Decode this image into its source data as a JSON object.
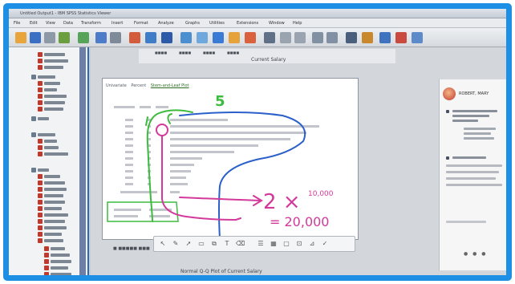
{
  "window": {
    "title": "Untitled Output1 - IBM SPSS Statistics Viewer"
  },
  "menu": [
    "File",
    "Edit",
    "View",
    "Data",
    "Transform",
    "Insert",
    "Format",
    "Analyze",
    "Graphs",
    "Utilities",
    "Extensions",
    "Window",
    "Help"
  ],
  "output_header": {
    "title": "Current Salary"
  },
  "page": {
    "tabs": [
      "Univariate",
      "Percent",
      "Stem-and-Leaf Plot"
    ]
  },
  "annotations": {
    "five": "5",
    "multiplier": "2 ×",
    "base": "10,000",
    "result": "= 20,000"
  },
  "chat": {
    "name": "ROBERT, MARY"
  },
  "bottom": {
    "title": "Normal Q-Q Plot of Current Salary"
  },
  "colors": {
    "accent": "#1d8fe5",
    "ink_pink": "#d3399a",
    "ink_blue": "#2b5fc9",
    "ink_green": "#3dbb3d"
  }
}
